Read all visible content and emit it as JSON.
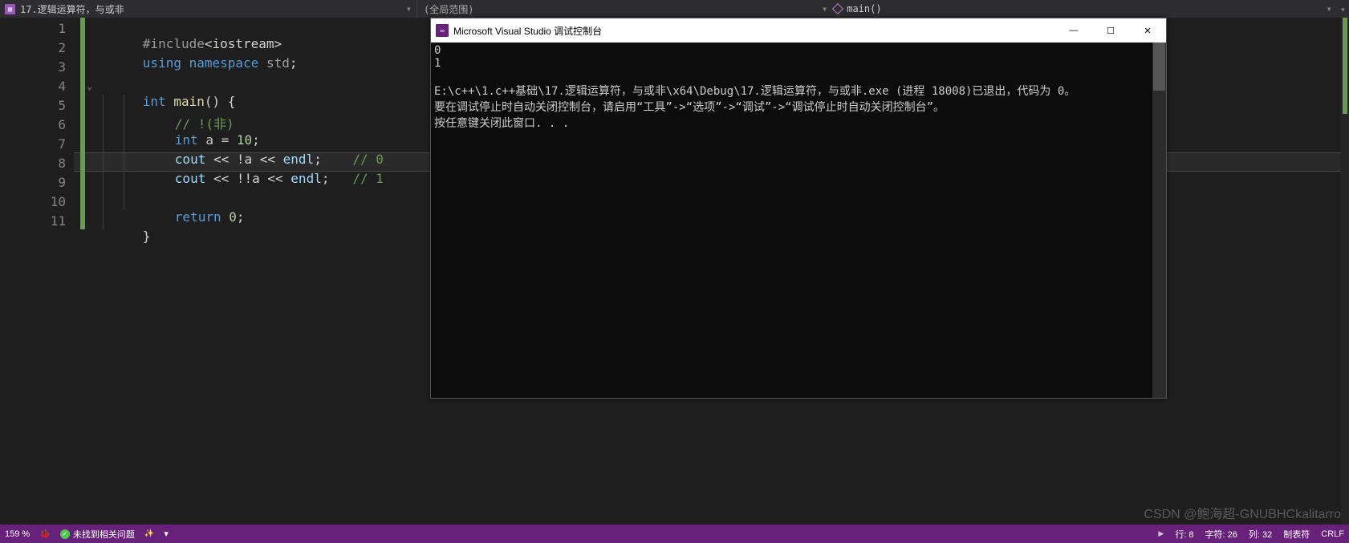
{
  "topbar": {
    "filename": "17.逻辑运算符，与或非",
    "scope": "(全局范围)",
    "function": "main()"
  },
  "editor": {
    "line_numbers": [
      "1",
      "2",
      "3",
      "4",
      "5",
      "6",
      "7",
      "8",
      "9",
      "10",
      "11"
    ],
    "current_line_index": 7,
    "code": {
      "l1_pre": "#include",
      "l1_inc": "<iostream>",
      "l2_kw1": "using",
      "l2_kw2": "namespace",
      "l2_ns": "std",
      "l2_semi": ";",
      "l4_type": "int",
      "l4_fn": "main",
      "l4_rest": "() {",
      "l5_cmt": "// !(非)",
      "l6_type": "int",
      "l6_rest": " a = ",
      "l6_num": "10",
      "l6_semi": ";",
      "l7_cout": "cout",
      "l7_mid": " << !a << ",
      "l7_endl": "endl",
      "l7_semi": ";",
      "l7_cmt": "// 0",
      "l8_cout": "cout",
      "l8_mid": " << !!a << ",
      "l8_endl": "endl",
      "l8_semi": ";",
      "l8_cmt": "// 1",
      "l10_kw": "return",
      "l10_val": " 0",
      "l10_semi": ";",
      "l11_brace": "}"
    }
  },
  "console": {
    "title": "Microsoft Visual Studio 调试控制台",
    "out1": "0",
    "out2": "1",
    "blank": "",
    "exit_line": "E:\\c++\\1.c++基础\\17.逻辑运算符，与或非\\x64\\Debug\\17.逻辑运算符，与或非.exe (进程 18008)已退出，代码为 0。",
    "hint_line": "要在调试停止时自动关闭控制台，请启用“工具”->“选项”->“调试”->“调试停止时自动关闭控制台”。",
    "press_line": "按任意键关闭此窗口. . ."
  },
  "statusbar": {
    "zoom": "159 %",
    "issues": "未找到相关问题",
    "line": "行: 8",
    "char": "字符: 26",
    "col": "列: 32",
    "tabs": "制表符",
    "eol": "CRLF"
  },
  "watermark": "CSDN @鲍海超-GNUBHCkalitarro"
}
